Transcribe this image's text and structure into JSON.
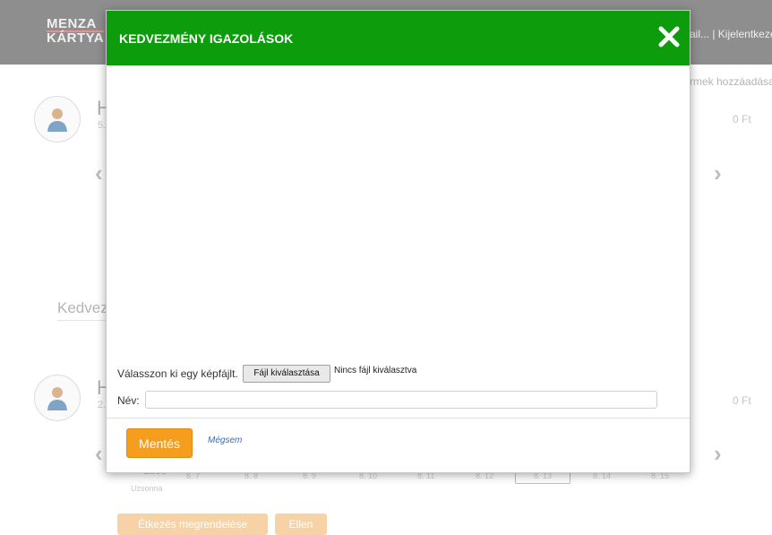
{
  "background": {
    "logo": {
      "line1": "MENZA",
      "line2": "KÁRTYA"
    },
    "header_links": "ail... | Kijelentkezés",
    "add_favorite": "rmek hozzáadása",
    "child1": {
      "initial": "H",
      "sub": "5.",
      "price": "0 Ft"
    },
    "child2": {
      "initial": "H",
      "sub": "2.",
      "price": "0 Ft"
    },
    "section_title": "Kedvez",
    "days": [
      "8. 7",
      "8. 8",
      "8. 9",
      "8. 10",
      "8. 11",
      "8. 12",
      "8. 13",
      "8. 14",
      "8. 15"
    ],
    "meal_label": "Uzsonna",
    "meal_top_label": "Ebéd",
    "buttons": [
      "Étkezés megrendelése",
      "Ellen"
    ]
  },
  "modal": {
    "title": "KEDVEZMÉNY IGAZOLÁSOK",
    "upload_label": "Válasszon ki egy képfájlt.",
    "file_button": "Fájl kiválasztása",
    "no_file": "Nincs fájl kiválasztva",
    "name_label": "Név:",
    "name_value": "",
    "save_button": "Mentés",
    "cancel_link": "Mégsem"
  },
  "colors": {
    "header_green": "#0c9c0c",
    "save_orange": "#f59d1c",
    "link_blue": "#2b6fc9"
  }
}
